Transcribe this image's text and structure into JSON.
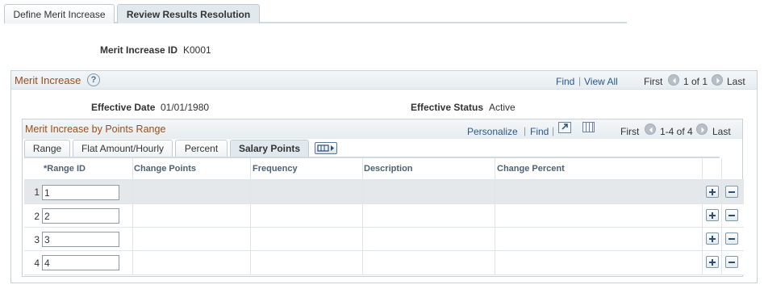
{
  "page_tabs": [
    {
      "label": "Define Merit Increase",
      "active": false
    },
    {
      "label": "Review Results Resolution",
      "active": true
    }
  ],
  "header": {
    "id_label": "Merit Increase ID",
    "id_value": "K0001"
  },
  "outer_grid": {
    "title": "Merit Increase",
    "help": "?",
    "find": "Find",
    "view_all": "View All",
    "first": "First",
    "count": "1 of 1",
    "last": "Last",
    "effective_date_label": "Effective Date",
    "effective_date": "01/01/1980",
    "effective_status_label": "Effective Status",
    "effective_status": "Active"
  },
  "inner_grid": {
    "title": "Merit Increase by Points Range",
    "personalize": "Personalize",
    "find": "Find",
    "first": "First",
    "count": "1-4 of 4",
    "last": "Last",
    "tabs": [
      {
        "label": "Range",
        "active": false
      },
      {
        "label": "Flat Amount/Hourly",
        "active": false
      },
      {
        "label": "Percent",
        "active": false
      },
      {
        "label": "Salary Points",
        "active": true
      }
    ],
    "columns": [
      "*Range ID",
      "Change Points",
      "Frequency",
      "Description",
      "Change Percent"
    ],
    "rows": [
      {
        "num": "1",
        "range_id": "1"
      },
      {
        "num": "2",
        "range_id": "2"
      },
      {
        "num": "3",
        "range_id": "3"
      },
      {
        "num": "4",
        "range_id": "4"
      }
    ]
  },
  "colors": {
    "accent_title": "#9f4d16",
    "link": "#29588a",
    "selected_row": "#e5e8ea"
  }
}
